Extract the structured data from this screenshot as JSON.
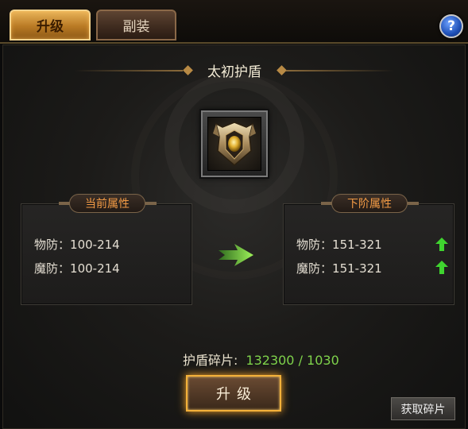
{
  "tabs": [
    {
      "label": "升级",
      "active": true
    },
    {
      "label": "副装",
      "active": false
    }
  ],
  "help": {
    "label": "?"
  },
  "item": {
    "name": "太初护盾",
    "icon": "shield-helm-icon"
  },
  "current": {
    "label": "当前属性",
    "stats": [
      {
        "name": "物防",
        "value": "100-214"
      },
      {
        "name": "魔防",
        "value": "100-214"
      }
    ]
  },
  "next": {
    "label": "下阶属性",
    "stats": [
      {
        "name": "物防",
        "value": "151-321",
        "trend": "up"
      },
      {
        "name": "魔防",
        "value": "151-321",
        "trend": "up"
      }
    ]
  },
  "fragments": {
    "label": "护盾碎片:",
    "value": "132300 / 1030"
  },
  "buttons": {
    "upgrade": "升级",
    "fetch": "获取碎片"
  },
  "colors": {
    "accent": "#f3b13a",
    "positive": "#7fd34b",
    "label": "#f19a45"
  }
}
